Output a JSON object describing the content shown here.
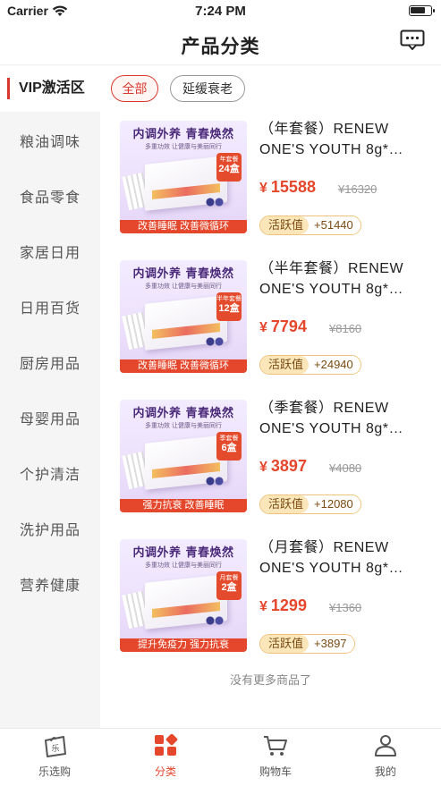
{
  "status_bar": {
    "carrier": "Carrier",
    "time": "7:24 PM"
  },
  "header": {
    "title": "产品分类"
  },
  "vip": {
    "label": "VIP激活区",
    "chips": [
      "全部",
      "延缓衰老"
    ]
  },
  "sidebar": {
    "items": [
      "粮油调味",
      "食品零食",
      "家居日用",
      "日用百货",
      "厨房用品",
      "母婴用品",
      "个护清洁",
      "洗护用品",
      "营养健康"
    ]
  },
  "thumb": {
    "headline": "内调外养 青春焕然",
    "tagline": "多重功效 让健康与美丽同行"
  },
  "products": [
    {
      "title": "（年套餐）RENEW ONE'S YOUTH 8g*…",
      "price": "15588",
      "original_price": "¥16320",
      "activity_label": "活跃值",
      "activity_value": "+51440",
      "strip": "改善睡眠 改善微循环",
      "badge_top": "年套餐",
      "badge_num": "24盒"
    },
    {
      "title": "（半年套餐）RENEW ONE'S YOUTH 8g*…",
      "price": "7794",
      "original_price": "¥8160",
      "activity_label": "活跃值",
      "activity_value": "+24940",
      "strip": "改善睡眠 改善微循环",
      "badge_top": "半年套餐",
      "badge_num": "12盒"
    },
    {
      "title": "（季套餐）RENEW ONE'S YOUTH 8g*…",
      "price": "3897",
      "original_price": "¥4080",
      "activity_label": "活跃值",
      "activity_value": "+12080",
      "strip": "强力抗衰 改善睡眠",
      "badge_top": "季套餐",
      "badge_num": "6盒"
    },
    {
      "title": "（月套餐）RENEW ONE'S YOUTH 8g*…",
      "price": "1299",
      "original_price": "¥1360",
      "activity_label": "活跃值",
      "activity_value": "+3897",
      "strip": "提升免疫力 强力抗衰",
      "badge_top": "月套餐",
      "badge_num": "2盒"
    }
  ],
  "currency": "¥",
  "list_footer": "没有更多商品了",
  "tabbar": {
    "items": [
      "乐选购",
      "分类",
      "购物车",
      "我的"
    ],
    "active": "分类"
  },
  "colors": {
    "accent": "#e4472c",
    "sidebar_bg": "#f5f5f5",
    "activity_bg": "#fbe6b9"
  },
  "icons": [
    "wifi-icon",
    "battery-icon",
    "message-icon",
    "shop-bag-icon",
    "category-icon",
    "cart-icon",
    "user-icon"
  ]
}
